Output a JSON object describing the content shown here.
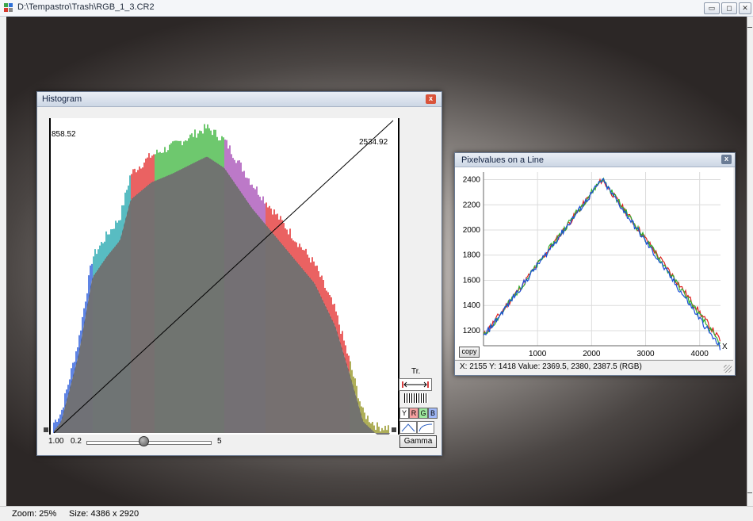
{
  "window": {
    "title": "D:\\Tempastro\\Trash\\RGB_1_3.CR2",
    "min_glyph": "▭",
    "max_glyph": "◻",
    "close_glyph": "✕"
  },
  "status": {
    "zoom": "Zoom: 25%",
    "size": "Size: 4386 x 2920"
  },
  "histogram": {
    "title": "Histogram",
    "close_glyph": "x",
    "min_level": "858.52",
    "max_level": "2534.92",
    "black_point": "1.00",
    "gamma_min": "0.2",
    "gamma_max": "5",
    "gamma_value_fraction": 0.46,
    "tr_label": "Tr.",
    "channels": {
      "y": "Y",
      "r": "R",
      "g": "G",
      "b": "B"
    },
    "gamma_button": "Gamma",
    "colors": {
      "r": "#e02020",
      "g": "#30b030",
      "b": "#1a4fd8",
      "cyan": "#11a0a8",
      "olive": "#8c8c10",
      "gray": "#707070",
      "purple": "#a040b0"
    }
  },
  "line_window": {
    "title": "Pixelvalues on a Line",
    "close_glyph": "x",
    "copy": "copy",
    "status": "X: 2155  Y: 1418  Value: 2369.5, 2380, 2387.5 (RGB)",
    "x_axis_label": "X"
  },
  "chart_data": {
    "type": "line",
    "x_ticks": [
      1000,
      2000,
      3000,
      4000
    ],
    "y_ticks": [
      1200,
      1400,
      1600,
      1800,
      2000,
      2200,
      2400
    ],
    "xlim": [
      0,
      4386
    ],
    "ylim": [
      1080,
      2460
    ],
    "xlabel": "X",
    "grid": true,
    "series": [
      {
        "color": "#e02020",
        "peak_x": 2193,
        "start_y": 1160,
        "peak_y": 2400,
        "end_y": 1120
      },
      {
        "color": "#30b030",
        "peak_x": 2193,
        "start_y": 1150,
        "peak_y": 2410,
        "end_y": 1090
      },
      {
        "color": "#1a4fd8",
        "peak_x": 2193,
        "start_y": 1150,
        "peak_y": 2400,
        "end_y": 1060
      }
    ]
  }
}
